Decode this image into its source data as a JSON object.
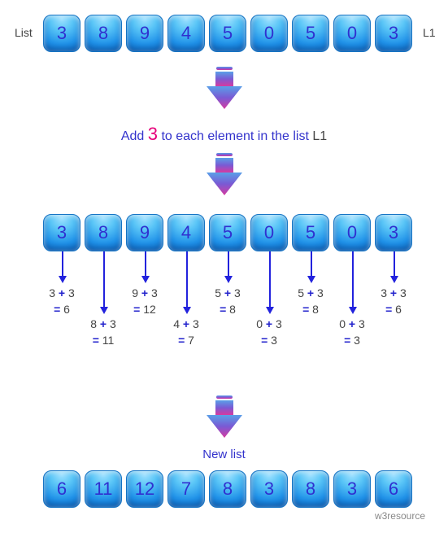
{
  "labels": {
    "list": "List",
    "l1": "L1",
    "new_list": "New list",
    "footer": "w3resource"
  },
  "caption": {
    "prefix": "Add ",
    "accent": "3",
    "mid": " to each element in the list ",
    "suffix": "L1"
  },
  "list1": [
    "3",
    "8",
    "9",
    "4",
    "5",
    "0",
    "5",
    "0",
    "3"
  ],
  "list2": [
    "3",
    "8",
    "9",
    "4",
    "5",
    "0",
    "5",
    "0",
    "3"
  ],
  "result": [
    "6",
    "11",
    "12",
    "7",
    "8",
    "3",
    "8",
    "3",
    "6"
  ],
  "add": "3",
  "exprs": [
    {
      "a": "3",
      "sum": "6",
      "row": 0
    },
    {
      "a": "8",
      "sum": "11",
      "row": 1
    },
    {
      "a": "9",
      "sum": "12",
      "row": 0
    },
    {
      "a": "4",
      "sum": "7",
      "row": 1
    },
    {
      "a": "5",
      "sum": "8",
      "row": 0
    },
    {
      "a": "0",
      "sum": "3",
      "row": 1
    },
    {
      "a": "5",
      "sum": "8",
      "row": 0
    },
    {
      "a": "0",
      "sum": "3",
      "row": 1
    },
    {
      "a": "3",
      "sum": "6",
      "row": 0
    }
  ],
  "chart_data": {
    "type": "table",
    "title": "Add 3 to each element in the list L1",
    "input_list": [
      3,
      8,
      9,
      4,
      5,
      0,
      5,
      0,
      3
    ],
    "addend": 3,
    "output_list": [
      6,
      11,
      12,
      7,
      8,
      3,
      8,
      3,
      6
    ]
  }
}
